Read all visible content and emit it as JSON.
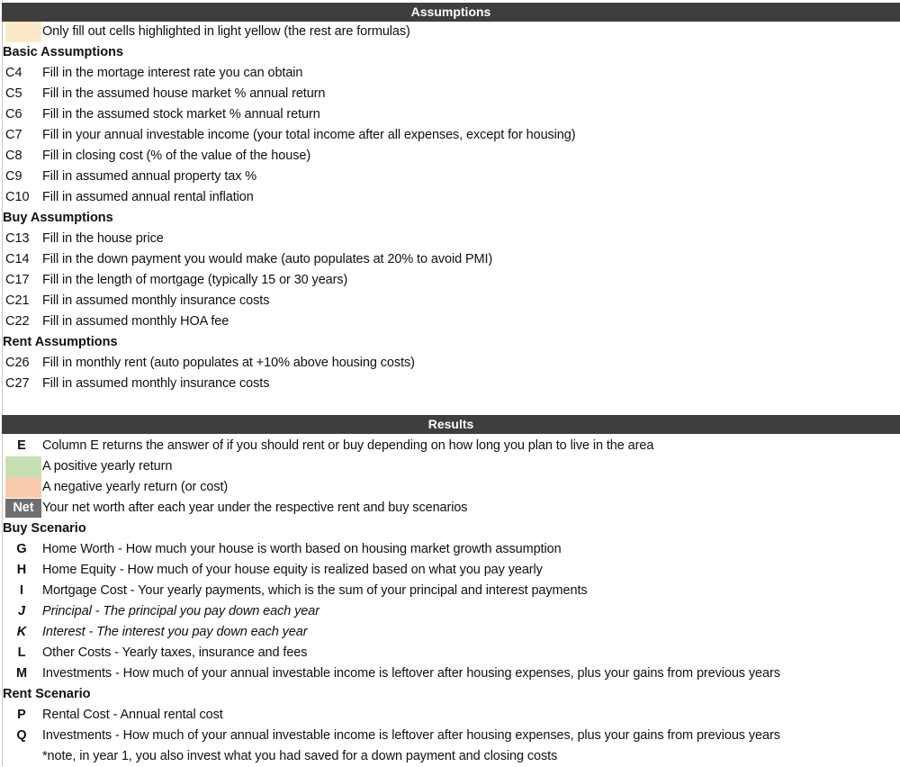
{
  "assumptions": {
    "title": "Assumptions",
    "note": "Only fill out cells highlighted in light yellow (the rest are formulas)",
    "note_swatch_color": "#fde9c8",
    "sections": [
      {
        "heading": "Basic Assumptions",
        "items": [
          {
            "cell": "C4",
            "text": "Fill in the mortage interest rate you can obtain"
          },
          {
            "cell": "C5",
            "text": "Fill in the assumed house market % annual return"
          },
          {
            "cell": "C6",
            "text": "Fill in the assumed stock market % annual return"
          },
          {
            "cell": "C7",
            "text": "Fill in your annual investable income (your total income after all expenses, except for housing)"
          },
          {
            "cell": "C8",
            "text": "Fill in closing cost (% of the value of the house)"
          },
          {
            "cell": "C9",
            "text": "Fill in assumed annual property tax %"
          },
          {
            "cell": "C10",
            "text": "Fill in assumed annual rental inflation"
          }
        ]
      },
      {
        "heading": "Buy Assumptions",
        "items": [
          {
            "cell": "C13",
            "text": "Fill in the house price"
          },
          {
            "cell": "C14",
            "text": "Fill in the down payment you would make (auto populates at 20% to avoid PMI)"
          },
          {
            "cell": "C17",
            "text": "Fill in the length of mortgage (typically 15 or 30 years)"
          },
          {
            "cell": "C21",
            "text": "Fill in assumed monthly insurance costs"
          },
          {
            "cell": "C22",
            "text": "Fill in assumed monthly HOA fee"
          }
        ]
      },
      {
        "heading": "Rent Assumptions",
        "items": [
          {
            "cell": "C26",
            "text": "Fill in monthly rent (auto populates at +10% above housing costs)"
          },
          {
            "cell": "C27",
            "text": "Fill in assumed monthly insurance costs"
          }
        ]
      }
    ]
  },
  "results": {
    "title": "Results",
    "legend": [
      {
        "key": "E",
        "text": "Column E returns the answer of if you should rent or buy depending on how long you plan to live in the area"
      },
      {
        "swatch_color": "#c6e0b4",
        "text": "A positive yearly return"
      },
      {
        "swatch_color": "#f8cbad",
        "text": "A negative yearly return (or cost)"
      },
      {
        "key": "Net",
        "key_color": "#6f6f6f",
        "text": "Your net worth after each year under the respective rent and buy scenarios"
      }
    ],
    "buy": {
      "heading": "Buy Scenario",
      "items": [
        {
          "col": "G",
          "text": "Home Worth - How much your house is worth based on housing market growth assumption"
        },
        {
          "col": "H",
          "text": "Home Equity - How much of your house equity is realized based on what you pay yearly"
        },
        {
          "col": "I",
          "text": "Mortgage Cost - Your yearly payments, which is the sum of your principal and interest payments"
        },
        {
          "col": "J",
          "text": "Principal - The principal you pay down each year"
        },
        {
          "col": "K",
          "text": "Interest - The interest you pay down each year"
        },
        {
          "col": "L",
          "text": "Other Costs - Yearly taxes, insurance and fees"
        },
        {
          "col": "M",
          "text": "Investments - How much of your annual investable income is leftover after housing expenses, plus your gains from previous years"
        }
      ]
    },
    "rent": {
      "heading": "Rent Scenario",
      "items": [
        {
          "col": "P",
          "text": "Rental Cost - Annual rental cost"
        },
        {
          "col": "Q",
          "text": "Investments - How much of your annual investable income is leftover after housing expenses, plus your gains from previous years"
        }
      ],
      "footnote": "*note, in year 1, you also invest what you had saved for a down payment and closing costs"
    }
  }
}
